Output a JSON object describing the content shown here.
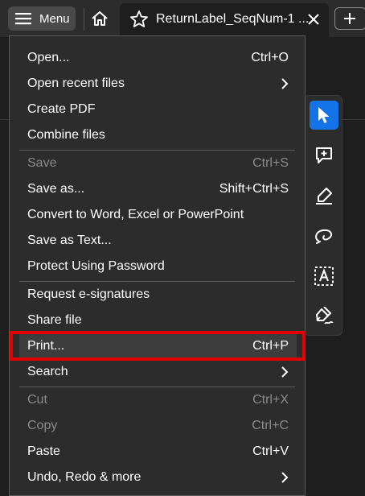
{
  "toolbar": {
    "menu_label": "Menu",
    "tab_title": "ReturnLabel_SeqNum-1 ..."
  },
  "menu": {
    "items": [
      {
        "label": "Open...",
        "shortcut": "Ctrl+O"
      },
      {
        "label": "Open recent files",
        "shortcut": ""
      },
      {
        "label": "Create PDF",
        "shortcut": ""
      },
      {
        "label": "Combine files",
        "shortcut": ""
      },
      {
        "label": "Save",
        "shortcut": "Ctrl+S"
      },
      {
        "label": "Save as...",
        "shortcut": "Shift+Ctrl+S"
      },
      {
        "label": "Convert to Word, Excel or PowerPoint",
        "shortcut": ""
      },
      {
        "label": "Save as Text...",
        "shortcut": ""
      },
      {
        "label": "Protect Using Password",
        "shortcut": ""
      },
      {
        "label": "Request e-signatures",
        "shortcut": ""
      },
      {
        "label": "Share file",
        "shortcut": ""
      },
      {
        "label": "Print...",
        "shortcut": "Ctrl+P"
      },
      {
        "label": "Search",
        "shortcut": ""
      },
      {
        "label": "Cut",
        "shortcut": "Ctrl+X"
      },
      {
        "label": "Copy",
        "shortcut": "Ctrl+C"
      },
      {
        "label": "Paste",
        "shortcut": "Ctrl+V"
      },
      {
        "label": "Undo, Redo & more",
        "shortcut": ""
      }
    ]
  },
  "tools": [
    "select-tool-icon",
    "add-comment-icon",
    "highlight-pen-icon",
    "draw-freehand-icon",
    "text-recognize-icon",
    "sign-icon"
  ],
  "colors": {
    "accent": "#1473e6",
    "highlight": "#e30000",
    "menu_bg": "#2c2c2c"
  }
}
